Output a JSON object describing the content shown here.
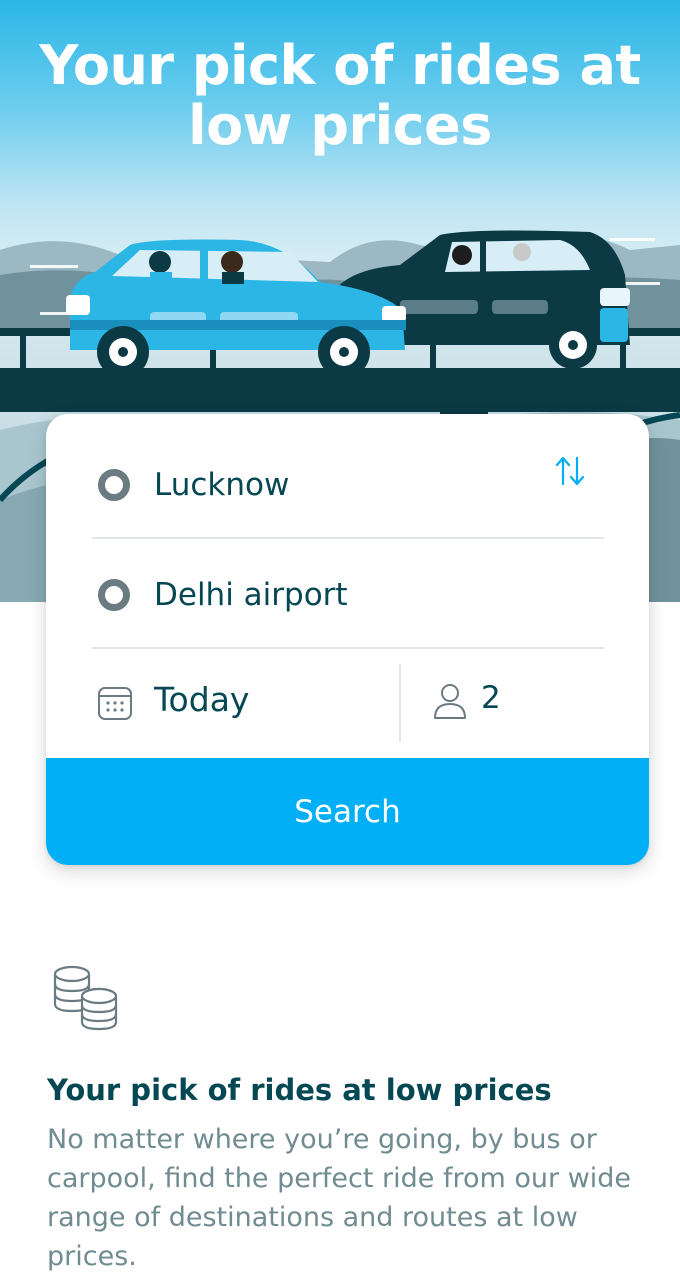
{
  "hero": {
    "title": "Your pick of rides at low prices"
  },
  "search": {
    "from": "Lucknow",
    "to": "Delhi airport",
    "date": "Today",
    "passengers": "2",
    "button_label": "Search"
  },
  "icons": {
    "from": "origin-circle-icon",
    "to": "destination-circle-icon",
    "swap": "swap-arrows-icon",
    "date": "calendar-icon",
    "passengers": "person-icon",
    "feature": "coins-icon"
  },
  "feature": {
    "title": "Your pick of rides at low prices",
    "description": "No matter where you’re going, by bus or carpool, find the perfect ride from our wide range of destinations and routes at low prices."
  },
  "colors": {
    "brand_blue": "#00aff5",
    "dark_teal": "#054752",
    "muted_text": "#708c91",
    "sky_top": "#2bb6e6"
  }
}
